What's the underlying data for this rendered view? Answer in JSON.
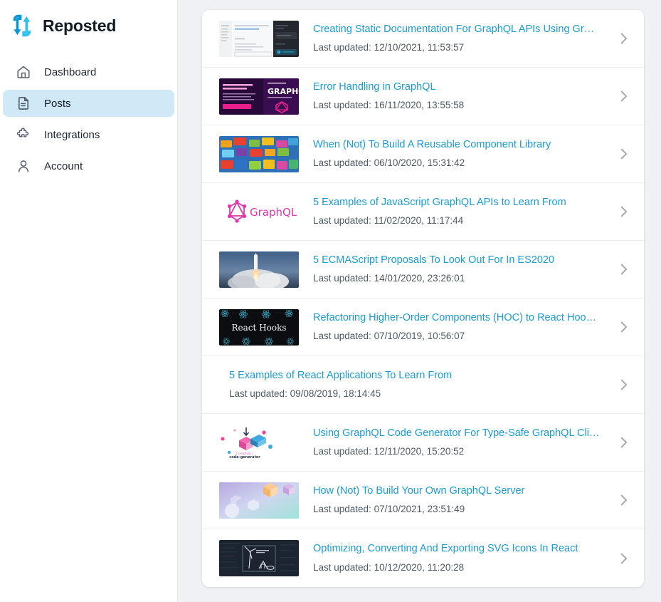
{
  "brand": {
    "name": "Reposted",
    "logo_icon": "repost-arrows-icon",
    "logo_color": "#1aa6e0"
  },
  "sidebar": {
    "items": [
      {
        "label": "Dashboard",
        "icon": "home-icon",
        "active": false
      },
      {
        "label": "Posts",
        "icon": "document-icon",
        "active": true
      },
      {
        "label": "Integrations",
        "icon": "puzzle-piece-icon",
        "active": false
      },
      {
        "label": "Account",
        "icon": "user-icon",
        "active": false
      }
    ],
    "active_background": "#cfe9f7"
  },
  "colors": {
    "page_background": "#f0f1f4",
    "card_background": "#ffffff",
    "link": "#1a9bd7",
    "meta_text": "#4f5963",
    "chevron": "#9aa6b5"
  },
  "posts": {
    "meta_prefix": "Last updated: ",
    "chevron_icon": "chevron-right-icon",
    "items": [
      {
        "title": "Creating Static Documentation For GraphQL APIs Using Gr…",
        "updated": "Last updated: 12/10/2021, 11:53:57",
        "thumbnail": "docs-and-code-editor-screenshot"
      },
      {
        "title": "Error Handling in GraphQL",
        "updated": "Last updated: 16/11/2020, 13:55:58",
        "thumbnail": "dark-purple-graphql-banner"
      },
      {
        "title": "When (Not) To Build A Reusable Component Library",
        "updated": "Last updated: 06/10/2020, 15:31:42",
        "thumbnail": "colorful-building-blocks-photo"
      },
      {
        "title": "5 Examples of JavaScript GraphQL APIs to Learn From",
        "updated": "Last updated: 11/02/2020, 11:17:44",
        "thumbnail": "graphql-pink-logo"
      },
      {
        "title": "5 ECMAScript Proposals To Look Out For In ES2020",
        "updated": "Last updated: 14/01/2020, 23:26:01",
        "thumbnail": "rocket-launch-photo"
      },
      {
        "title": "Refactoring Higher-Order Components (HOC) to React Hoo…",
        "updated": "Last updated: 07/10/2019, 10:56:07",
        "thumbnail": "react-hooks-dark-banner"
      },
      {
        "title": "5 Examples of React Applications To Learn From",
        "updated": "Last updated: 09/08/2019, 18:14:45",
        "thumbnail": null
      },
      {
        "title": "Using GraphQL Code Generator For Type-Safe GraphQL Cli…",
        "updated": "Last updated: 12/11/2020, 15:20:52",
        "thumbnail": "graphql-code-generator-illustration"
      },
      {
        "title": "How (Not) To Build Your Own GraphQL Server",
        "updated": "Last updated: 07/10/2021, 23:51:49",
        "thumbnail": "pastel-gradient-cubes"
      },
      {
        "title": "Optimizing, Converting And Exporting SVG Icons In React",
        "updated": "Last updated: 10/12/2020, 11:20:28",
        "thumbnail": "dark-windmill-line-art"
      }
    ]
  }
}
